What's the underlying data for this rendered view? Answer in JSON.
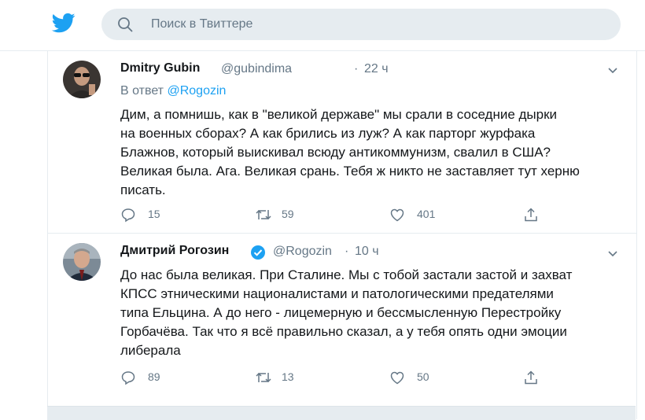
{
  "header": {
    "search_placeholder": "Поиск в Твиттере",
    "brand_color": "#1da1f2"
  },
  "tweets": [
    {
      "name": "Dmitry Gubin",
      "handle": "@gubindima",
      "separator": "·",
      "time": "22 ч",
      "reply_prefix": "В ответ",
      "reply_handle": "@Rogozin",
      "text_lines": [
        "Дим, а помнишь, как в \"великой державе\" мы срали в соседние дырки",
        "на военных сборах? А как брились из луж? А как парторг журфака",
        "Блажнов, который выискивал всюду антикоммунизм, свалил в США?",
        "Великая была. Ага. Великая срань. Тебя ж никто не заставляет тут херню",
        "писать."
      ],
      "replies": "15",
      "retweets": "59",
      "likes": "401"
    },
    {
      "name": "Дмитрий Рогозин",
      "verified": true,
      "handle": "@Rogozin",
      "separator": "·",
      "time": "10 ч",
      "text_lines": [
        "До нас была великая. При Сталине. Мы с тобой застали застой и захват",
        "КПСС этническими националистами и патологическими предателями",
        "типа Ельцина. А до него - лицемерную и бессмысленную Перестройку",
        "Горбачёва. Так что я всё правильно сказал, а у тебя опять одни эмоции",
        "либерала"
      ],
      "replies": "89",
      "retweets": "13",
      "likes": "50"
    }
  ]
}
